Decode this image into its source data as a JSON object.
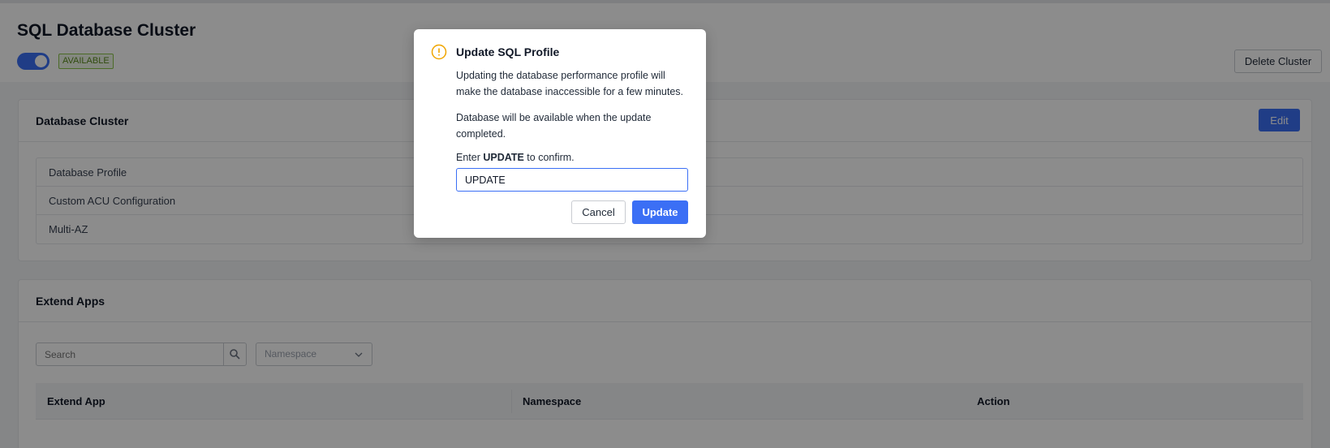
{
  "header": {
    "title": "SQL Database Cluster",
    "toggle_on": true,
    "status_badge": "AVAILABLE",
    "delete_label": "Delete Cluster"
  },
  "database_cluster": {
    "title": "Database Cluster",
    "edit_label": "Edit",
    "properties": [
      "Database Profile",
      "Custom ACU Configuration",
      "Multi-AZ"
    ]
  },
  "extend_apps": {
    "title": "Extend Apps",
    "search_placeholder": "Search",
    "namespace_placeholder": "Namespace",
    "columns": [
      "Extend App",
      "Namespace",
      "Action"
    ]
  },
  "modal": {
    "title": "Update SQL Profile",
    "text1": "Updating the database performance profile will make the database inaccessible for a few minutes.",
    "text2": "Database will be available when the update completed.",
    "confirm_prefix": "Enter ",
    "confirm_keyword": "UPDATE",
    "confirm_suffix": " to confirm.",
    "input_value": "UPDATE",
    "cancel_label": "Cancel",
    "update_label": "Update"
  },
  "colors": {
    "primary": "#3b6ff5",
    "warning": "#f0a500",
    "badge_green": "#5a8a1e"
  }
}
